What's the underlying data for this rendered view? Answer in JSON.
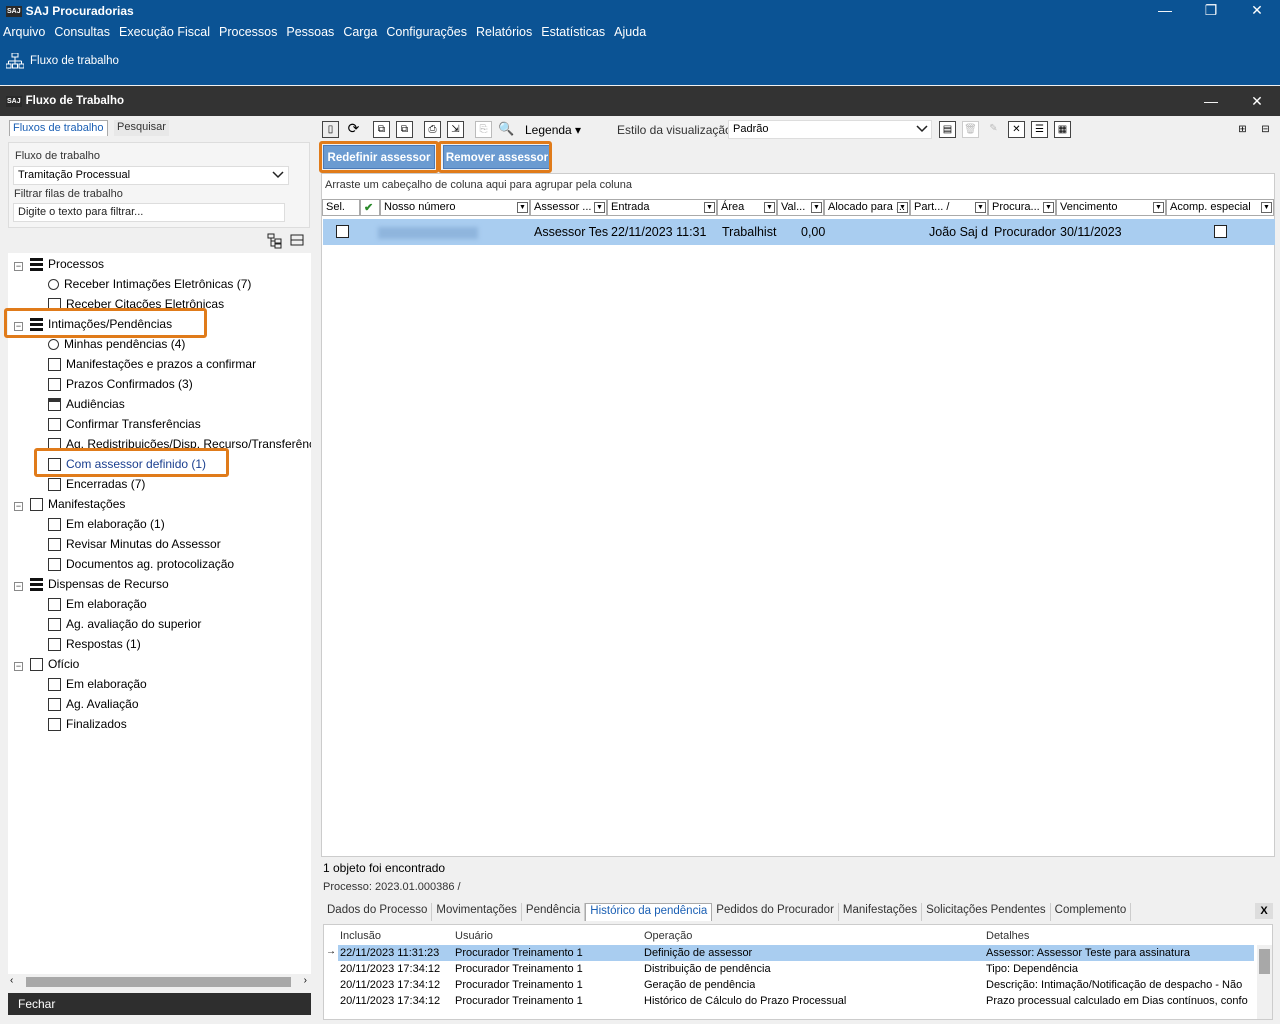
{
  "app": {
    "logo": "SAJ",
    "title": "SAJ Procuradorias",
    "win_min": "—",
    "win_max": "❐",
    "win_close": "✕"
  },
  "menu": [
    "Arquivo",
    "Consultas",
    "Execução Fiscal",
    "Processos",
    "Pessoas",
    "Carga",
    "Configurações",
    "Relatórios",
    "Estatísticas",
    "Ajuda"
  ],
  "toolbar": {
    "workflow_label": "Fluxo de trabalho"
  },
  "window": {
    "title": "Fluxo de Trabalho",
    "min": "—",
    "close": "✕"
  },
  "left": {
    "tabs": [
      "Fluxos de trabalho",
      "Pesquisar"
    ],
    "flow_label": "Fluxo de trabalho",
    "flow_value": "Tramitação Processual",
    "filter_label": "Filtrar filas de trabalho",
    "filter_value": "Digite o texto para filtrar...",
    "tree": [
      {
        "label": "Processos",
        "level": 0,
        "icon": "list-icon",
        "exp": "−"
      },
      {
        "label": "Receber Intimações Eletrônicas (7)",
        "level": 1,
        "icon": "info-icon"
      },
      {
        "label": "Receber Citações Eletrônicas",
        "level": 1,
        "icon": "document-icon"
      },
      {
        "label": "Intimações/Pendências",
        "level": 0,
        "icon": "list-icon",
        "exp": "−"
      },
      {
        "label": "Minhas pendências (4)",
        "level": 1,
        "icon": "info-icon"
      },
      {
        "label": "Manifestações e prazos a confirmar",
        "level": 1,
        "icon": "document-icon"
      },
      {
        "label": "Prazos Confirmados (3)",
        "level": 1,
        "icon": "document-icon"
      },
      {
        "label": "Audiências",
        "level": 1,
        "icon": "calendar-icon"
      },
      {
        "label": "Confirmar Transferências",
        "level": 1,
        "icon": "transfer-icon"
      },
      {
        "label": "Ag. Redistribuições/Disp. Recurso/Transferênc",
        "level": 1,
        "icon": "queue-icon"
      },
      {
        "label": "Com assessor definido (1)",
        "level": 1,
        "icon": "queue-icon"
      },
      {
        "label": "Encerradas (7)",
        "level": 1,
        "icon": "queue-icon"
      },
      {
        "label": "Manifestações",
        "level": 0,
        "icon": "clipboard-icon",
        "exp": "−"
      },
      {
        "label": "Em elaboração (1)",
        "level": 1,
        "icon": "clipboard-icon"
      },
      {
        "label": "Revisar Minutas do Assessor",
        "level": 1,
        "icon": "document-icon"
      },
      {
        "label": "Documentos ag. protocolização",
        "level": 1,
        "icon": "stamp-icon"
      },
      {
        "label": "Dispensas de Recurso",
        "level": 0,
        "icon": "list-icon",
        "exp": "−"
      },
      {
        "label": "Em elaboração",
        "level": 1,
        "icon": "clipboard-icon"
      },
      {
        "label": "Ag. avaliação do superior",
        "level": 1,
        "icon": "queue-icon"
      },
      {
        "label": "Respostas (1)",
        "level": 1,
        "icon": "document-icon"
      },
      {
        "label": "Ofício",
        "level": 0,
        "icon": "clipboard-icon",
        "exp": "−"
      },
      {
        "label": "Em elaboração",
        "level": 1,
        "icon": "clipboard-icon"
      },
      {
        "label": "Ag. Avaliação",
        "level": 1,
        "icon": "document-icon"
      },
      {
        "label": "Finalizados",
        "level": 1,
        "icon": "queue-icon"
      }
    ],
    "close_label": "Fechar"
  },
  "main": {
    "legend_label": "Legenda",
    "view_style_label": "Estilo da visualização",
    "view_style_value": "Padrão",
    "redefine_label": "Redefinir assessor",
    "remove_label": "Remover assessor",
    "group_hint": "Arraste um cabeçalho de coluna aqui para agrupar pela coluna",
    "columns": [
      "Sel.",
      "",
      "Nosso número",
      "Assessor ...",
      "Entrada",
      "Área",
      "Val...",
      "Alocado para ...",
      "Part... /",
      "Procura...",
      "Vencimento",
      "Acomp. especial"
    ],
    "row": {
      "assessor": "Assessor Tes",
      "entrada": "22/11/2023 11:31",
      "area": "Trabalhist",
      "valor": "0,00",
      "parte": "João Saj d",
      "procurador": "Procurador",
      "vencimento": "30/11/2023"
    },
    "found": "1 objeto foi encontrado",
    "process_line": "Processo: 2023.01.000386 /",
    "detail_tabs": [
      "Dados do Processo",
      "Movimentações",
      "Pendência",
      "Histórico da pendência",
      "Pedidos do Procurador",
      "Manifestações",
      "Solicitações Pendentes",
      "Complemento"
    ],
    "detail_close": "X",
    "hist_headers": [
      "Inclusão",
      "Usuário",
      "Operação",
      "Detalhes"
    ],
    "hist_rows": [
      {
        "inc": "22/11/2023 11:31:23",
        "user": "Procurador Treinamento 1",
        "op": "Definição de assessor",
        "det": "Assessor: Assessor Teste para assinatura"
      },
      {
        "inc": "20/11/2023 17:34:12",
        "user": "Procurador Treinamento 1",
        "op": "Distribuição de pendência",
        "det": "Tipo: Dependência"
      },
      {
        "inc": "20/11/2023 17:34:12",
        "user": "Procurador Treinamento 1",
        "op": "Geração de pendência",
        "det": "Descrição: Intimação/Notificação de despacho - Não"
      },
      {
        "inc": "20/11/2023 17:34:12",
        "user": "Procurador Treinamento 1",
        "op": "Histórico de Cálculo do Prazo Processual",
        "det": "Prazo processual calculado em Dias contínuos, confo"
      }
    ]
  }
}
